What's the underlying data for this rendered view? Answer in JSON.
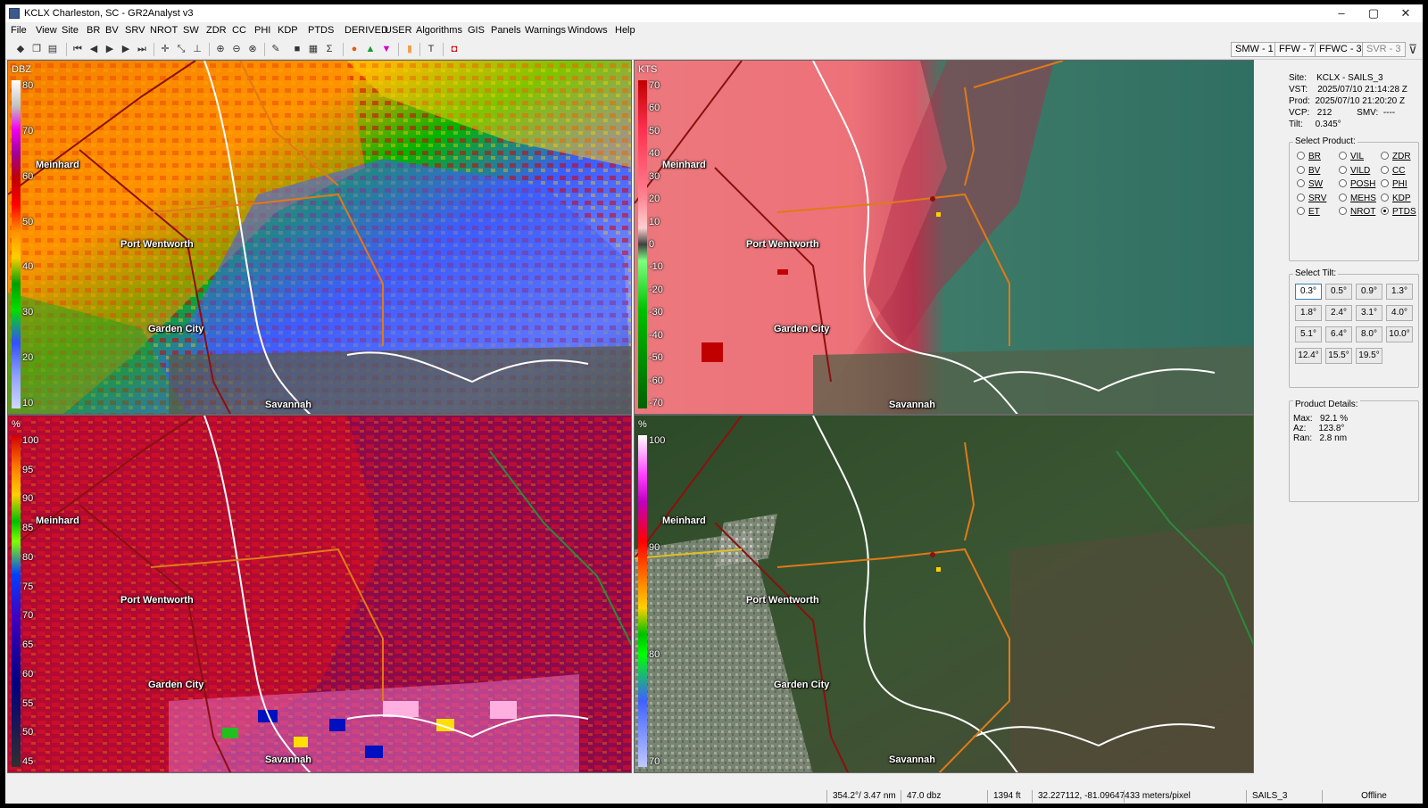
{
  "window": {
    "title": "KCLX Charleston, SC - GR2Analyst v3",
    "minimize_glyph": "–",
    "maximize_glyph": "▢",
    "close_glyph": "✕"
  },
  "menu": [
    "File",
    "View",
    "Site",
    "BR",
    "BV",
    "SRV",
    "NROT",
    "SW",
    "ZDR",
    "CC",
    "PHI",
    "KDP",
    "PTDS",
    "DERIVED",
    "USER",
    "Algorithms",
    "GIS",
    "Panels",
    "Warnings",
    "Windows",
    "Help"
  ],
  "toolbar_icons": [
    "open-icon",
    "copy-icon",
    "save-icon",
    "first-frame-icon",
    "prev-frame-icon",
    "play-icon",
    "next-frame-icon",
    "last-frame-icon",
    "crosshair-icon",
    "measure-icon",
    "tool-icon",
    "zoom-in-icon",
    "zoom-out-icon",
    "zoom-reset-icon",
    "pencil-icon",
    "stop-icon",
    "grid-icon",
    "sigma-icon",
    "storm-icon",
    "triangle-up-icon",
    "triangle-down-icon",
    "marker-icon",
    "text-icon",
    "record-icon"
  ],
  "warnings": {
    "smw": "SMW - 1",
    "ffw": "FFW - 7",
    "ffwc": "FFWC - 3",
    "svr": "SVR - 3"
  },
  "filter_glyph": "⊽",
  "panels": {
    "tl": {
      "unit": "DBZ",
      "labels": [
        "80",
        "70",
        "60",
        "50",
        "40",
        "30",
        "20",
        "10"
      ]
    },
    "tr": {
      "unit": "KTS",
      "labels": [
        "70",
        "60",
        "50",
        "40",
        "30",
        "20",
        "10",
        "0",
        "-10",
        "-20",
        "-30",
        "-40",
        "-50",
        "-60",
        "-70"
      ]
    },
    "bl": {
      "unit": "%",
      "labels": [
        "100",
        "95",
        "90",
        "85",
        "80",
        "75",
        "70",
        "65",
        "60",
        "55",
        "50",
        "45"
      ]
    },
    "br": {
      "unit": "%",
      "labels": [
        "100",
        "90",
        "80",
        "70"
      ]
    }
  },
  "cities": [
    "Meinhard",
    "Port Wentworth",
    "Garden City",
    "Savannah"
  ],
  "site_info": {
    "site_label": "Site:",
    "site": "KCLX - SAILS_3",
    "vst_label": "VST:",
    "vst": "2025/07/10  21:14:28 Z",
    "prod_label": "Prod:",
    "prod": "2025/07/10  21:20:20 Z",
    "vcp_label": "VCP:",
    "vcp": "212",
    "smv_label": "SMV:",
    "smv": "----",
    "tilt_label": "Tilt:",
    "tilt": "0.345°"
  },
  "select_product": {
    "title": "Select Product:",
    "items": [
      "BR",
      "VIL",
      "ZDR",
      "BV",
      "VILD",
      "CC",
      "SW",
      "POSH",
      "PHI",
      "SRV",
      "MEHS",
      "KDP",
      "ET",
      "NROT",
      "PTDS"
    ],
    "selected": "PTDS"
  },
  "select_tilt": {
    "title": "Select Tilt:",
    "items": [
      "0.3°",
      "0.5°",
      "0.9°",
      "1.3°",
      "1.8°",
      "2.4°",
      "3.1°",
      "4.0°",
      "5.1°",
      "6.4°",
      "8.0°",
      "10.0°",
      "12.4°",
      "15.5°",
      "19.5°"
    ],
    "selected": "0.3°"
  },
  "product_details": {
    "title": "Product Details:",
    "max_label": "Max:",
    "max": "92.1 %",
    "az_label": "Az:",
    "az": "123.8°",
    "ran_label": "Ran:",
    "ran": "2.8 nm"
  },
  "status": {
    "azran": "354.2°/ 3.47 nm",
    "value": "47.0 dbz",
    "height": "1394 ft",
    "coords": "32.227112, -81.096474",
    "scale": "33 meters/pixel",
    "mode": "SAILS_3",
    "state": "Offline"
  },
  "colors": {
    "ref_ramp": [
      "#f000f0",
      "#c00000",
      "#e00000",
      "#ff8c00",
      "#ffd000",
      "#00a000",
      "#00d000",
      "#3050ff",
      "#8fa0ff",
      "#c0c8ff"
    ],
    "vel_ramp": [
      "#ff3050",
      "#c00000",
      "#800000",
      "#333333",
      "#006000",
      "#00c000"
    ],
    "sat_base": "#3b4a2e",
    "road_color": "#e07a18",
    "hwy_color": "#8a1010"
  }
}
